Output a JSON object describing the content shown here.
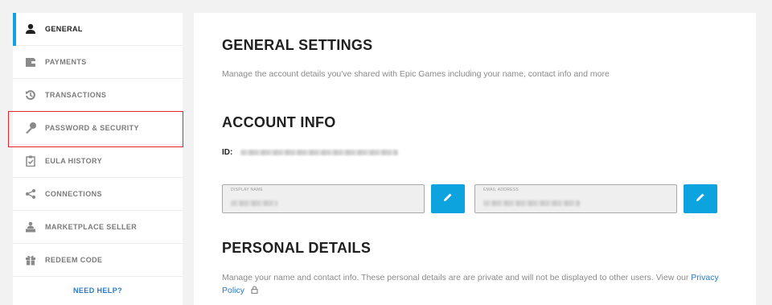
{
  "sidebar": {
    "items": [
      {
        "label": "GENERAL",
        "icon": "user-icon"
      },
      {
        "label": "PAYMENTS",
        "icon": "wallet-icon"
      },
      {
        "label": "TRANSACTIONS",
        "icon": "history-icon"
      },
      {
        "label": "PASSWORD & SECURITY",
        "icon": "key-icon"
      },
      {
        "label": "EULA HISTORY",
        "icon": "clipboard-check-icon"
      },
      {
        "label": "CONNECTIONS",
        "icon": "share-icon"
      },
      {
        "label": "MARKETPLACE SELLER",
        "icon": "seller-icon"
      },
      {
        "label": "REDEEM CODE",
        "icon": "gift-icon"
      }
    ],
    "active_index": 0,
    "need_help": "NEED HELP?"
  },
  "general": {
    "title": "GENERAL SETTINGS",
    "description": "Manage the account details you've shared with Epic Games including your name, contact info and more"
  },
  "account": {
    "title": "ACCOUNT INFO",
    "id_label": "ID:",
    "display_name_label": "DISPLAY NAME",
    "email_label": "EMAIL ADDRESS"
  },
  "personal": {
    "title": "PERSONAL DETAILS",
    "description": "Manage your name and contact info. These personal details are are private and will not be displayed to other users. View our",
    "privacy_link": "Privacy Policy"
  },
  "colors": {
    "accent": "#0ca3de",
    "link": "#2a79c9",
    "highlight": "#e0262b"
  }
}
